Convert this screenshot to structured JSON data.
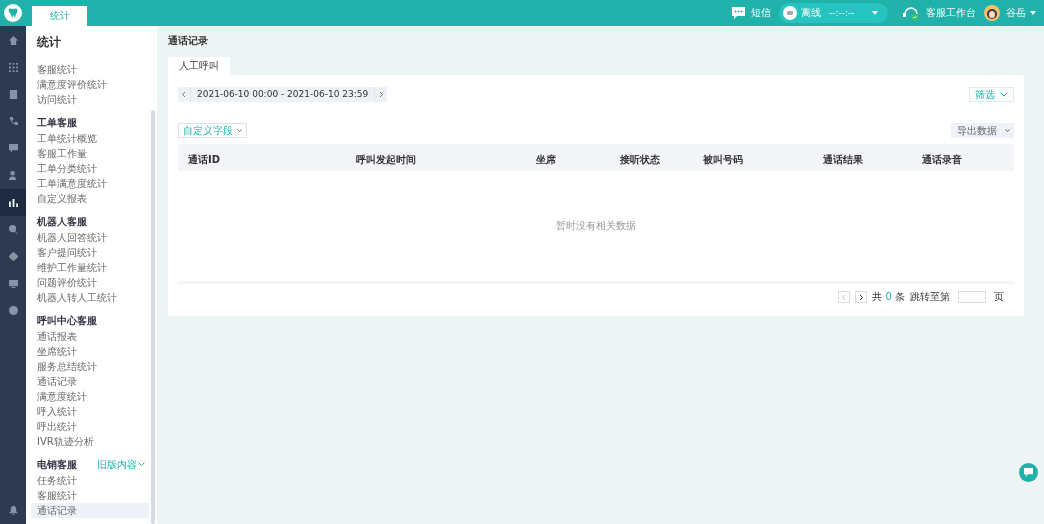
{
  "top_tab": {
    "label": "统计",
    "selected": true
  },
  "header": {
    "sms": "短信",
    "status": "离线",
    "timer": "--:--:--",
    "workbench": "客服工作台",
    "user": "谷岳"
  },
  "rail": [
    {
      "selected": false
    },
    {
      "selected": false
    },
    {
      "selected": false
    },
    {
      "selected": false
    },
    {
      "selected": false
    },
    {
      "selected": false
    },
    {
      "selected": true
    },
    {
      "selected": false
    },
    {
      "selected": false
    },
    {
      "selected": false
    },
    {
      "selected": false
    }
  ],
  "sidebar": {
    "title": "统计",
    "groups": [
      {
        "items": [
          {
            "label": "客服统计",
            "selected": false
          },
          {
            "label": "满意度评价统计",
            "selected": false
          },
          {
            "label": "访问统计",
            "selected": false
          }
        ]
      },
      {
        "title": "工单客服",
        "items": [
          {
            "label": "工单统计概览",
            "selected": false
          },
          {
            "label": "客服工作量",
            "selected": false
          },
          {
            "label": "工单分类统计",
            "selected": false
          },
          {
            "label": "工单满意度统计",
            "selected": false
          },
          {
            "label": "自定义报表",
            "selected": false
          }
        ]
      },
      {
        "title": "机器人客服",
        "items": [
          {
            "label": "机器人回答统计",
            "selected": false
          },
          {
            "label": "客户提问统计",
            "selected": false
          },
          {
            "label": "维护工作量统计",
            "selected": false
          },
          {
            "label": "问题评价统计",
            "selected": false
          },
          {
            "label": "机器人转人工统计",
            "selected": false
          }
        ]
      },
      {
        "title": "呼叫中心客服",
        "items": [
          {
            "label": "通话报表",
            "selected": false
          },
          {
            "label": "坐席统计",
            "selected": false
          },
          {
            "label": "服务总结统计",
            "selected": false
          },
          {
            "label": "通话记录",
            "selected": false
          },
          {
            "label": "满意度统计",
            "selected": false
          },
          {
            "label": "呼入统计",
            "selected": false
          },
          {
            "label": "呼出统计",
            "selected": false
          },
          {
            "label": "IVR轨迹分析",
            "selected": false
          }
        ]
      },
      {
        "title": "电销客服",
        "link": "旧版内容",
        "items": [
          {
            "label": "任务统计",
            "selected": false
          },
          {
            "label": "客服统计",
            "selected": false
          },
          {
            "label": "通话记录",
            "selected": true
          }
        ]
      }
    ]
  },
  "page_title": "通话记录",
  "tabs": [
    {
      "label": "人工呼叫",
      "selected": true
    }
  ],
  "date_range": "2021-06-10 00:00 - 2021-06-10 23:59",
  "filter_button": "筛选",
  "custom_fields_button": "自定义字段",
  "export_button": "导出数据",
  "table": {
    "columns": [
      "通话ID",
      "呼叫发起时间",
      "坐席",
      "接听状态",
      "被叫号码",
      "通话结果",
      "通话录音"
    ],
    "empty_text": "暂时没有相关数据"
  },
  "pagination": {
    "total_prefix": "共",
    "total": "0",
    "total_suffix": "条",
    "jump_label": "跳转至第",
    "page_suffix": "页"
  }
}
